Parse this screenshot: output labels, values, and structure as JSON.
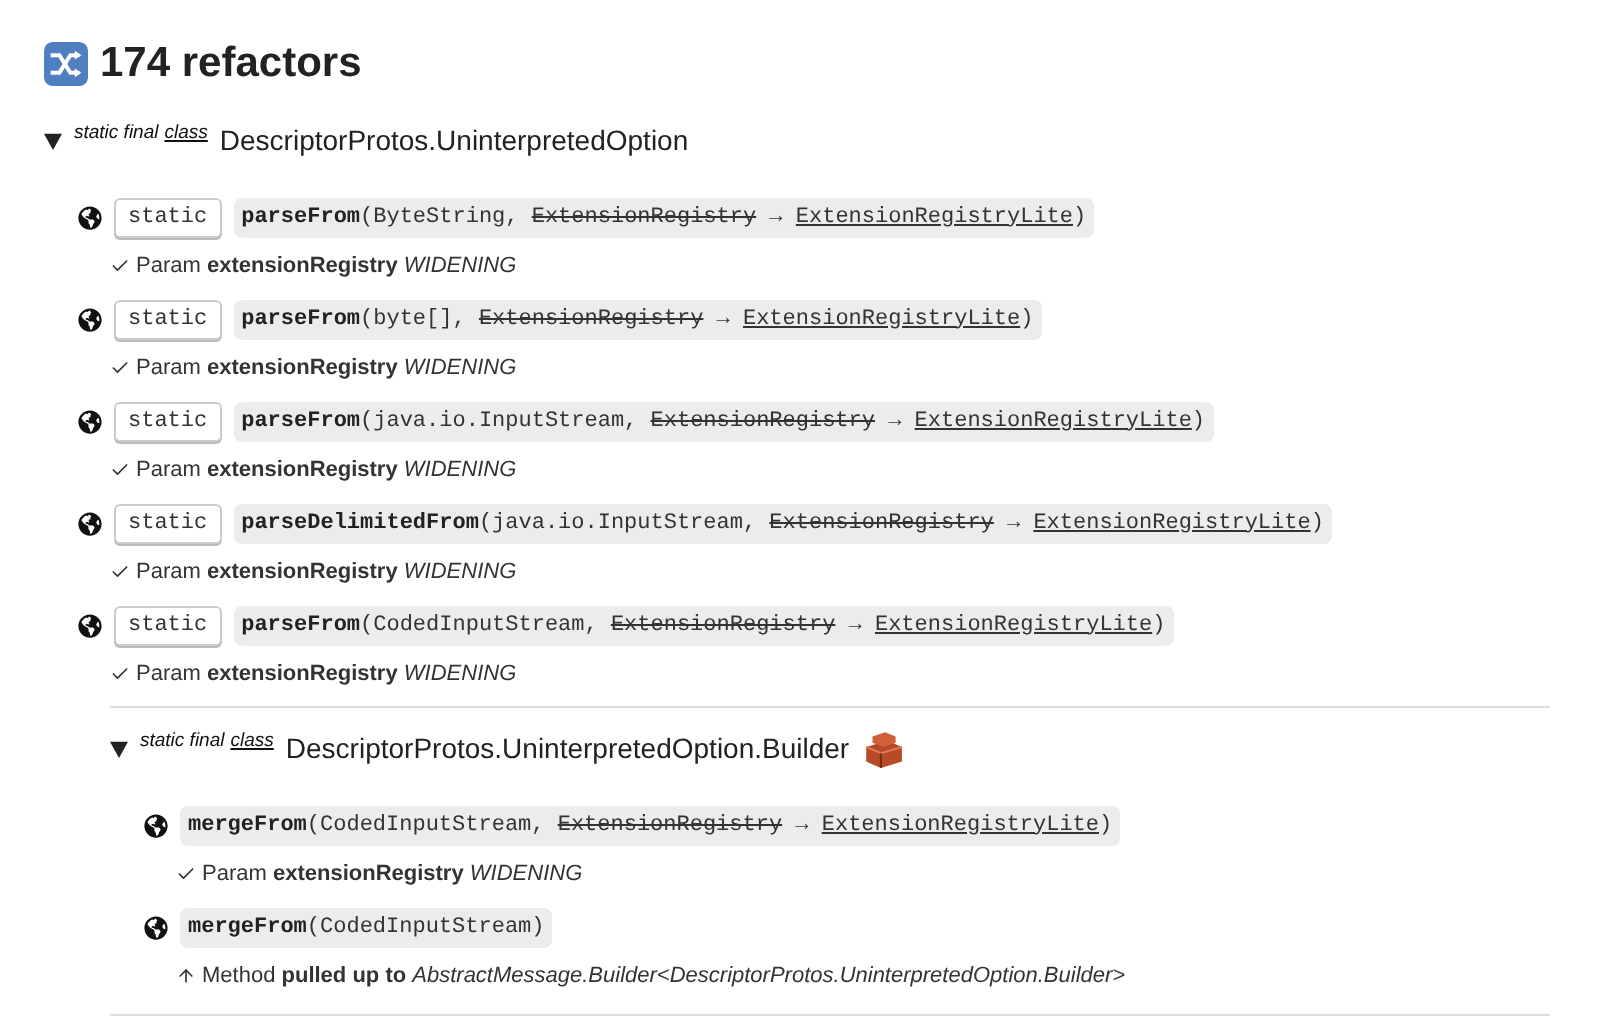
{
  "title": "174 refactors",
  "classes": [
    {
      "modifiers": "static final",
      "keyword": "class",
      "name": "DescriptorProtos.UninterpretedOption",
      "expanded": true,
      "badge": false,
      "members": [
        {
          "modifier": "static",
          "signature": [
            {
              "kind": "name",
              "text": "parseFrom"
            },
            {
              "kind": "plain",
              "text": "(ByteString, "
            },
            {
              "kind": "removed",
              "text": "ExtensionRegistry"
            },
            {
              "kind": "plain",
              "text": " → "
            },
            {
              "kind": "added",
              "text": "ExtensionRegistryLite"
            },
            {
              "kind": "plain",
              "text": ")"
            }
          ],
          "note": {
            "kind": "check",
            "text": "Param **extensionRegistry** *WIDENING*"
          }
        },
        {
          "modifier": "static",
          "signature": [
            {
              "kind": "name",
              "text": "parseFrom"
            },
            {
              "kind": "plain",
              "text": "(byte[], "
            },
            {
              "kind": "removed",
              "text": "ExtensionRegistry"
            },
            {
              "kind": "plain",
              "text": " → "
            },
            {
              "kind": "added",
              "text": "ExtensionRegistryLite"
            },
            {
              "kind": "plain",
              "text": ")"
            }
          ],
          "note": {
            "kind": "check",
            "text": "Param **extensionRegistry** *WIDENING*"
          }
        },
        {
          "modifier": "static",
          "signature": [
            {
              "kind": "name",
              "text": "parseFrom"
            },
            {
              "kind": "plain",
              "text": "(java.io.InputStream, "
            },
            {
              "kind": "removed",
              "text": "ExtensionRegistry"
            },
            {
              "kind": "plain",
              "text": " → "
            },
            {
              "kind": "added",
              "text": "ExtensionRegistryLite"
            },
            {
              "kind": "plain",
              "text": ")"
            }
          ],
          "note": {
            "kind": "check",
            "text": "Param **extensionRegistry** *WIDENING*"
          }
        },
        {
          "modifier": "static",
          "signature": [
            {
              "kind": "name",
              "text": "parseDelimitedFrom"
            },
            {
              "kind": "plain",
              "text": "(java.io.InputStream, "
            },
            {
              "kind": "removed",
              "text": "ExtensionRegistry"
            },
            {
              "kind": "plain",
              "text": " → "
            },
            {
              "kind": "added",
              "text": "ExtensionRegistryLite"
            },
            {
              "kind": "plain",
              "text": ")"
            }
          ],
          "note": {
            "kind": "check",
            "text": "Param **extensionRegistry** *WIDENING*"
          }
        },
        {
          "modifier": "static",
          "signature": [
            {
              "kind": "name",
              "text": "parseFrom"
            },
            {
              "kind": "plain",
              "text": "(CodedInputStream, "
            },
            {
              "kind": "removed",
              "text": "ExtensionRegistry"
            },
            {
              "kind": "plain",
              "text": " → "
            },
            {
              "kind": "added",
              "text": "ExtensionRegistryLite"
            },
            {
              "kind": "plain",
              "text": ")"
            }
          ],
          "note": {
            "kind": "check",
            "text": "Param **extensionRegistry** *WIDENING*"
          }
        }
      ],
      "children": [
        {
          "modifiers": "static final",
          "keyword": "class",
          "name": "DescriptorProtos.UninterpretedOption.Builder",
          "expanded": true,
          "badge": true,
          "members": [
            {
              "signature": [
                {
                  "kind": "name",
                  "text": "mergeFrom"
                },
                {
                  "kind": "plain",
                  "text": "(CodedInputStream, "
                },
                {
                  "kind": "removed",
                  "text": "ExtensionRegistry"
                },
                {
                  "kind": "plain",
                  "text": " → "
                },
                {
                  "kind": "added",
                  "text": "ExtensionRegistryLite"
                },
                {
                  "kind": "plain",
                  "text": ")"
                }
              ],
              "note": {
                "kind": "check",
                "text": "Param **extensionRegistry** *WIDENING*"
              }
            },
            {
              "signature": [
                {
                  "kind": "name",
                  "text": "mergeFrom"
                },
                {
                  "kind": "plain",
                  "text": "(CodedInputStream)"
                }
              ],
              "note": {
                "kind": "up",
                "text": "Method **pulled up to** *AbstractMessage.Builder<DescriptorProtos.UninterpretedOption.Builder>*"
              }
            }
          ]
        }
      ]
    }
  ]
}
